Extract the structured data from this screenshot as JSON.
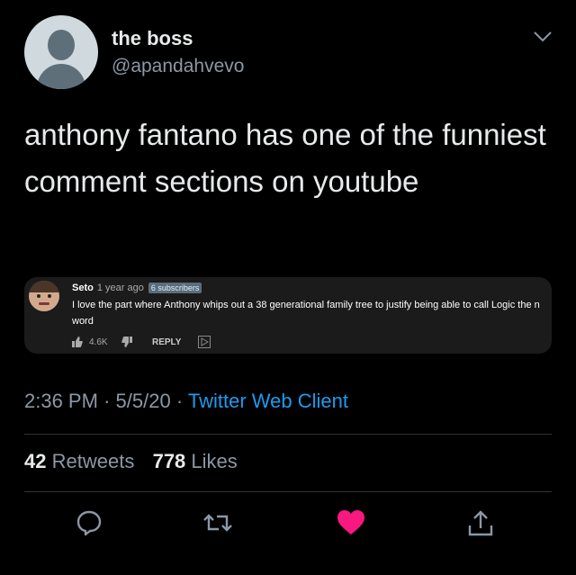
{
  "header": {
    "display_name": "the boss",
    "handle": "@apandahvevo"
  },
  "tweet": {
    "text": "anthony fantano has one of the funniest comment sections on youtube"
  },
  "embedded_comment": {
    "author": "Seto",
    "time": "1 year ago",
    "badge": "6 subscribers",
    "text": "I love the part where Anthony whips out a 38 generational family tree to justify being able to call Logic the n word",
    "likes": "4.6K",
    "reply_label": "REPLY"
  },
  "meta": {
    "time": "2:36 PM",
    "date": "5/5/20",
    "client": "Twitter Web Client",
    "sep": "·"
  },
  "stats": {
    "retweets": "42",
    "retweets_label": "Retweets",
    "likes": "778",
    "likes_label": "Likes"
  },
  "colors": {
    "background": "#000000",
    "link": "#1d9bf0",
    "like_active": "#f91880",
    "secondary_text": "#8b98a5"
  },
  "icons": [
    "avatar-placeholder",
    "chevron-down-icon",
    "thumbs-up-icon",
    "thumbs-down-icon",
    "replay-icon",
    "reply-icon",
    "retweet-icon",
    "heart-icon",
    "share-icon"
  ]
}
